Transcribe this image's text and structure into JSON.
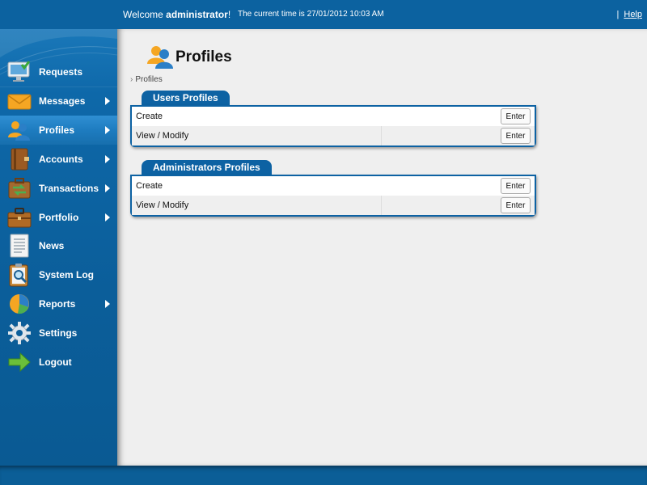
{
  "header": {
    "welcome_prefix": "Welcome ",
    "username": "administrator",
    "welcome_suffix": "!",
    "time_text": "The current time is 27/01/2012 10:03 AM",
    "separator": "|",
    "help_label": "Help"
  },
  "sidebar": {
    "items": [
      {
        "label": "Requests",
        "icon": "monitor-icon",
        "has_submenu": false
      },
      {
        "label": "Messages",
        "icon": "envelope-icon",
        "has_submenu": true
      },
      {
        "label": "Profiles",
        "icon": "users-icon",
        "has_submenu": true,
        "active": true
      },
      {
        "label": "Accounts",
        "icon": "book-icon",
        "has_submenu": true
      },
      {
        "label": "Transactions",
        "icon": "transfer-icon",
        "has_submenu": true
      },
      {
        "label": "Portfolio",
        "icon": "briefcase-icon",
        "has_submenu": true
      },
      {
        "label": "News",
        "icon": "document-icon",
        "has_submenu": false
      },
      {
        "label": "System Log",
        "icon": "magnifier-clipboard-icon",
        "has_submenu": false
      },
      {
        "label": "Reports",
        "icon": "pie-chart-icon",
        "has_submenu": true
      },
      {
        "label": "Settings",
        "icon": "gear-icon",
        "has_submenu": false
      },
      {
        "label": "Logout",
        "icon": "arrow-right-icon",
        "has_submenu": false
      }
    ]
  },
  "main": {
    "title": "Profiles",
    "breadcrumb_sep": "›",
    "breadcrumb": "Profiles",
    "sections": [
      {
        "title": "Users Profiles",
        "rows": [
          {
            "label": "Create",
            "button": "Enter"
          },
          {
            "label": "View / Modify",
            "button": "Enter"
          }
        ]
      },
      {
        "title": "Administrators Profiles",
        "rows": [
          {
            "label": "Create",
            "button": "Enter"
          },
          {
            "label": "View / Modify",
            "button": "Enter"
          }
        ]
      }
    ]
  },
  "colors": {
    "brand_blue": "#0c62a0",
    "active_item": "#1e7cc0",
    "content_bg": "#efefef"
  }
}
